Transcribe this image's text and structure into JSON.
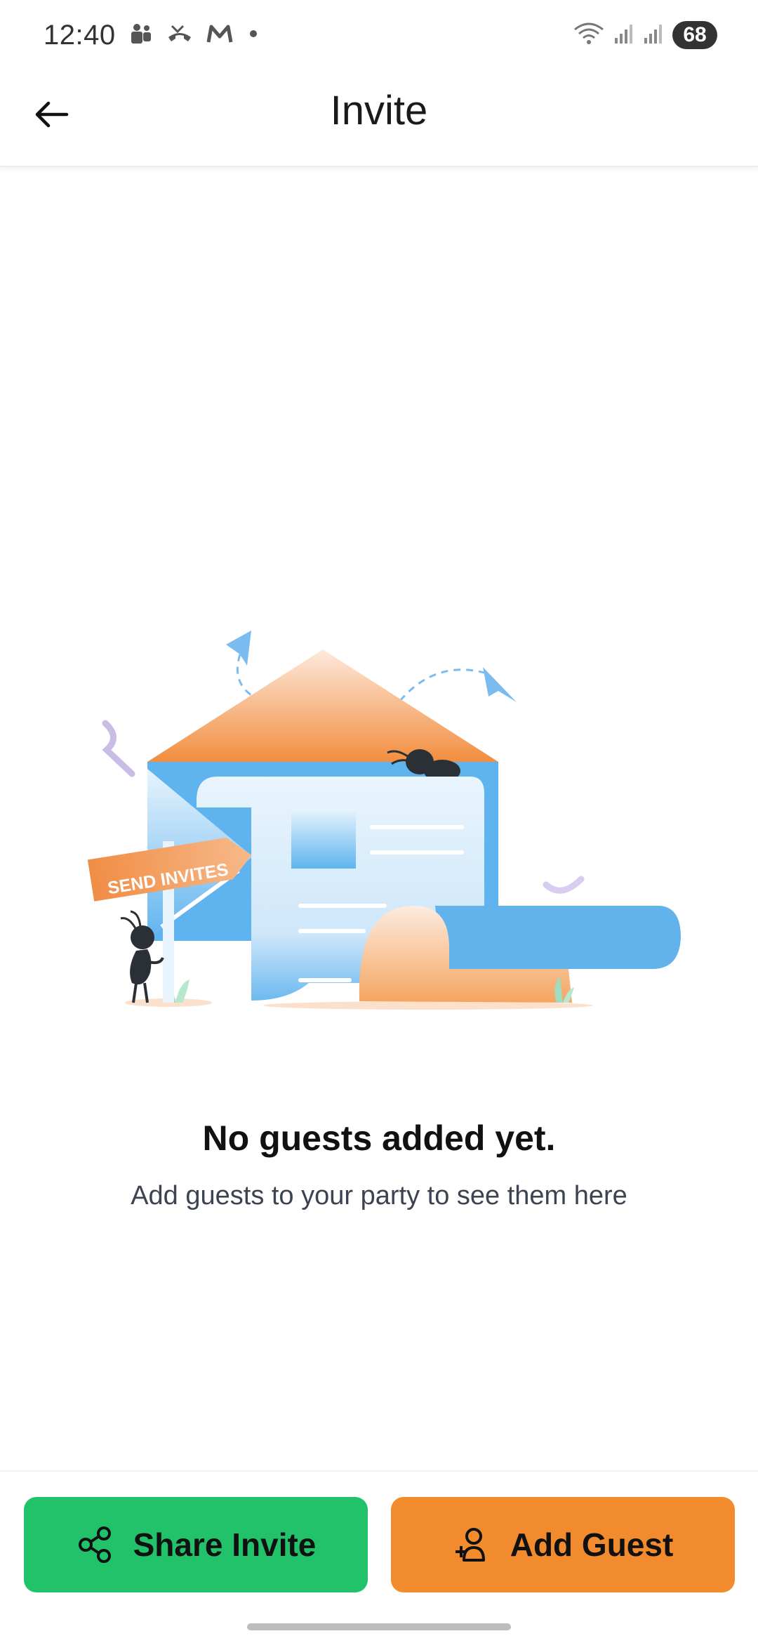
{
  "status_bar": {
    "time": "12:40",
    "battery_level": "68",
    "icons": [
      "teams-icon",
      "missed-call-icon",
      "gmail-icon",
      "notification-dot-icon",
      "wifi-icon",
      "signal-icon",
      "signal-icon"
    ]
  },
  "header": {
    "title": "Invite",
    "back_icon": "arrow-left-icon"
  },
  "illustration": {
    "sign_text": "SEND INVITES"
  },
  "empty_state": {
    "title": "No guests added yet.",
    "subtitle": "Add guests to your party to see them here"
  },
  "actions": {
    "share_label": "Share Invite",
    "share_icon": "share-icon",
    "add_label": "Add Guest",
    "add_icon": "add-person-icon"
  },
  "colors": {
    "share_button": "#22c26a",
    "add_button": "#f28a2e",
    "envelope_blue": "#5fb3ee",
    "envelope_orange": "#f4a460"
  }
}
